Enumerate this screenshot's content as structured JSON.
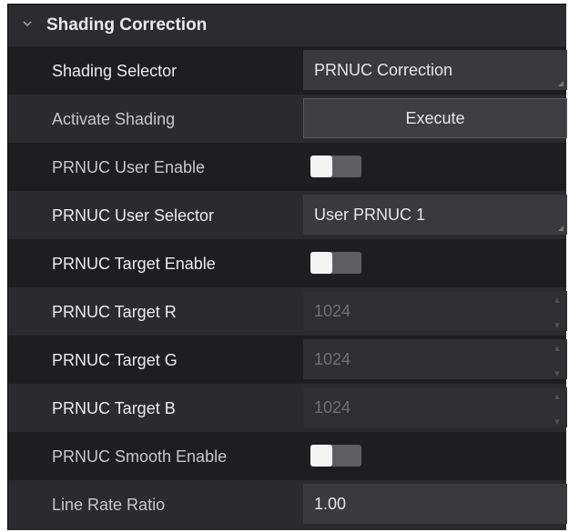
{
  "section": {
    "title": "Shading Correction",
    "expanded_icon": "chevron-down-icon"
  },
  "rows": {
    "shading_selector": {
      "label": "Shading Selector",
      "value": "PRNUC Correction"
    },
    "activate_shading": {
      "label": "Activate Shading",
      "button": "Execute"
    },
    "prnuc_user_enable": {
      "label": "PRNUC User Enable",
      "enabled": false
    },
    "prnuc_user_selector": {
      "label": "PRNUC User Selector",
      "value": "User PRNUC 1"
    },
    "prnuc_target_enable": {
      "label": "PRNUC Target Enable",
      "enabled": false
    },
    "prnuc_target_r": {
      "label": "PRNUC Target R",
      "value": "1024"
    },
    "prnuc_target_g": {
      "label": "PRNUC Target G",
      "value": "1024"
    },
    "prnuc_target_b": {
      "label": "PRNUC Target B",
      "value": "1024"
    },
    "prnuc_smooth_enable": {
      "label": "PRNUC Smooth Enable",
      "enabled": false
    },
    "line_rate_ratio": {
      "label": "Line Rate Ratio",
      "value": "1.00"
    }
  },
  "colors": {
    "panel_bg": "#2b2b2e",
    "alt_row_bg": "#1e1e20",
    "field_bg": "#3a3a3d",
    "toggle_track": "#5e5e62",
    "toggle_knob": "#f4f4f4"
  }
}
